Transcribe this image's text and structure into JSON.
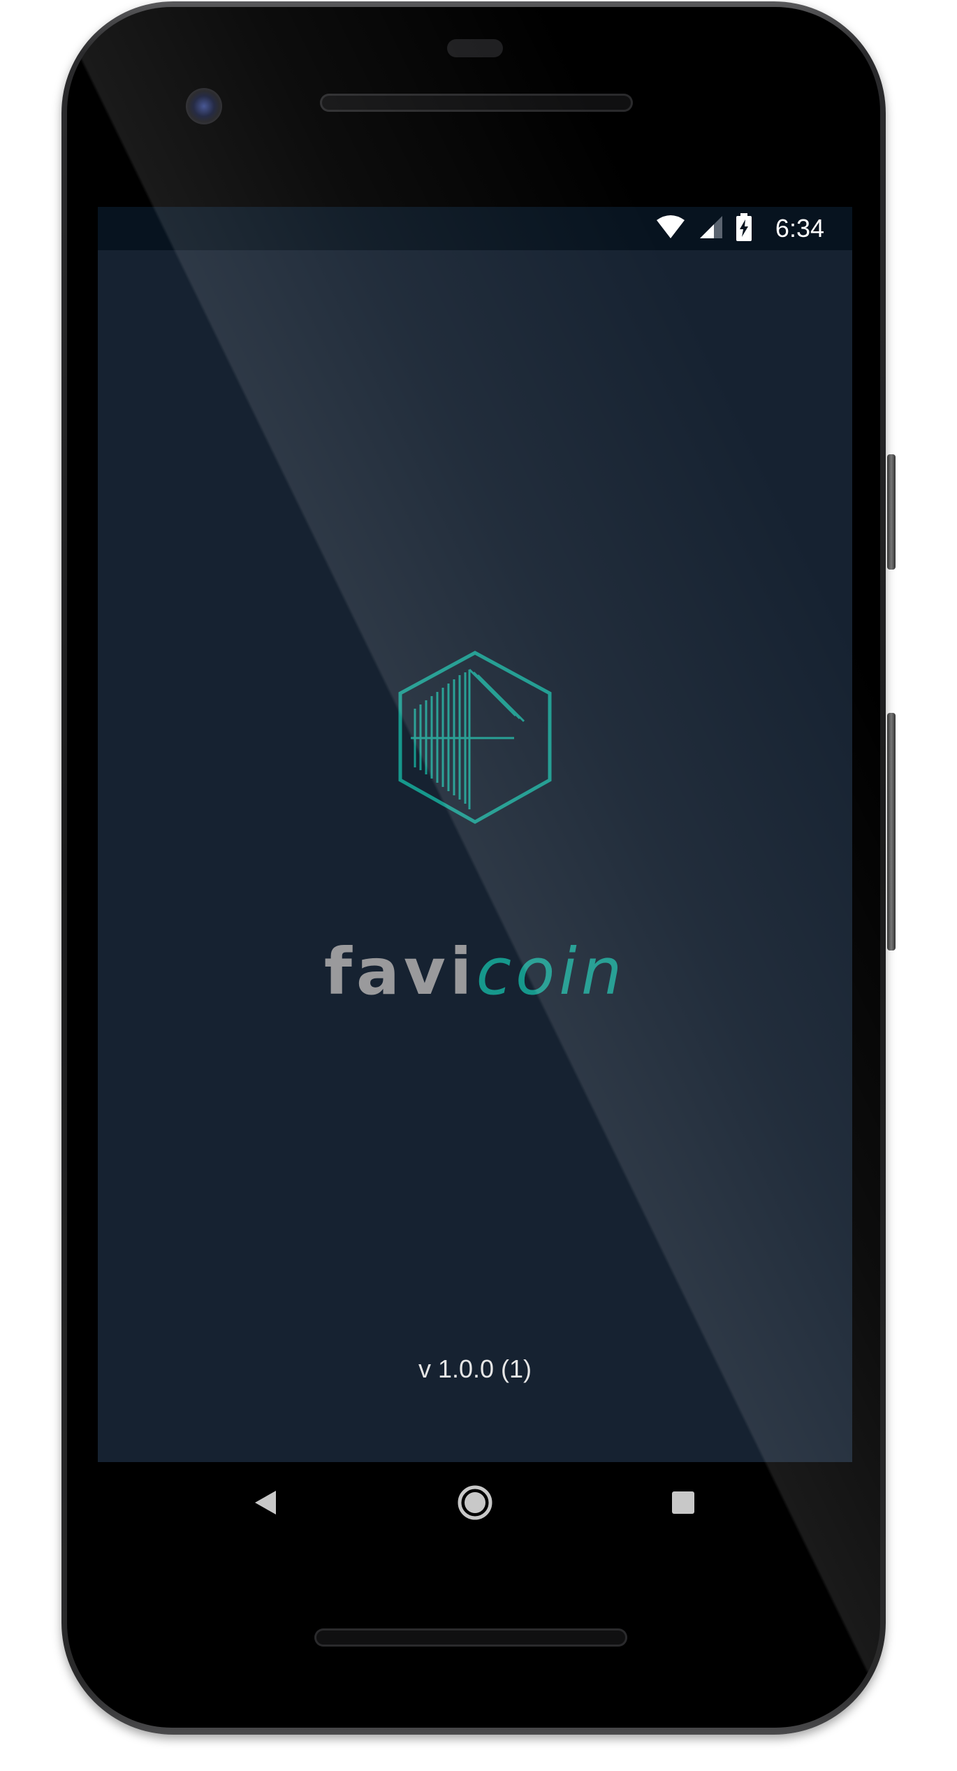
{
  "status_bar": {
    "time": "6:34",
    "wifi_icon": "wifi-icon",
    "signal_icon": "cellular-signal-icon",
    "battery_icon": "battery-charging-icon"
  },
  "splash": {
    "logo_icon": "favicoin-hexagon-logo",
    "brand_part1": "favi",
    "brand_part2": "coin",
    "version": "v 1.0.0 (1)"
  },
  "nav_bar": {
    "back_icon": "back-triangle-icon",
    "home_icon": "home-circle-icon",
    "recents_icon": "recents-square-icon"
  },
  "colors": {
    "screen_background": "#162231",
    "status_bar_background": "#07131f",
    "accent_teal": "#16988c",
    "brand_grey": "#9a9a9c"
  }
}
